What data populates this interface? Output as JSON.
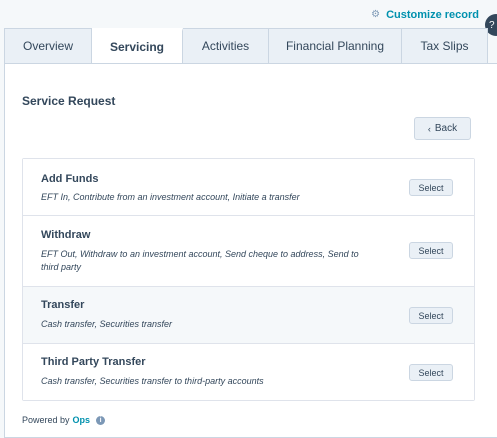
{
  "header": {
    "customize_label": "Customize record",
    "customize_icon": "gear-icon"
  },
  "tabs": [
    {
      "label": "Overview",
      "active": false
    },
    {
      "label": "Servicing",
      "active": true
    },
    {
      "label": "Activities",
      "active": false
    },
    {
      "label": "Financial Planning",
      "active": false
    },
    {
      "label": "Tax Slips",
      "active": false
    }
  ],
  "service_request": {
    "title": "Service Request",
    "back_label": "Back",
    "items": [
      {
        "title": "Add Funds",
        "description": "EFT In, Contribute from an investment account, Initiate a transfer",
        "select_label": "Select"
      },
      {
        "title": "Withdraw",
        "description": "EFT Out, Withdraw to an investment account, Send cheque to address, Send to third party",
        "select_label": "Select"
      },
      {
        "title": "Transfer",
        "description": "Cash transfer, Securities transfer",
        "select_label": "Select"
      },
      {
        "title": "Third Party Transfer",
        "description": "Cash transfer, Securities transfer to third-party accounts",
        "select_label": "Select"
      }
    ]
  },
  "footer": {
    "powered_by": "Powered by",
    "brand": "Ops",
    "info_icon": "info-icon"
  },
  "colors": {
    "accent": "#0091ae",
    "text": "#33475b",
    "border": "#cbd6e2",
    "tab_bg": "#eaf0f6"
  }
}
